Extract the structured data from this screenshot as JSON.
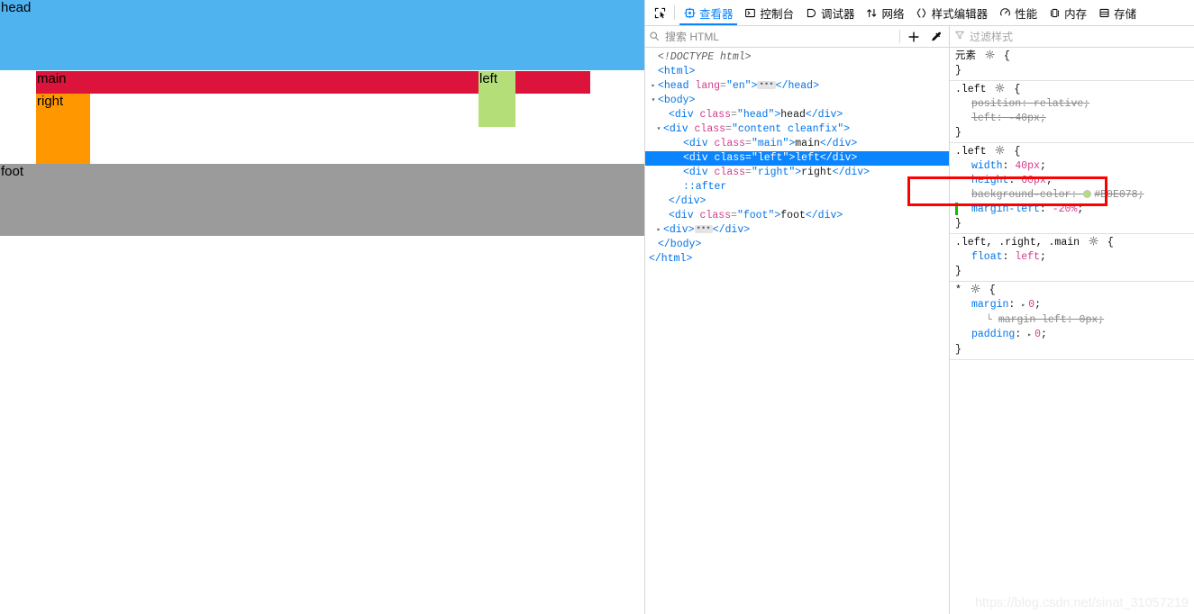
{
  "rendered_page": {
    "blocks": [
      {
        "name": "head",
        "label": "head",
        "color": "#4FB3F0"
      },
      {
        "name": "main",
        "label": "main",
        "color": "#DC143C"
      },
      {
        "name": "left",
        "label": "left",
        "color": "#B3DE78"
      },
      {
        "name": "right",
        "label": "right",
        "color": "#FF9800"
      },
      {
        "name": "foot",
        "label": "foot",
        "color": "#9B9B9B"
      }
    ]
  },
  "devtools": {
    "picker_icon": "element-picker-icon",
    "tabs": [
      {
        "id": "inspector",
        "label": "查看器",
        "icon": "inspector-icon",
        "active": true
      },
      {
        "id": "console",
        "label": "控制台",
        "icon": "console-icon",
        "active": false
      },
      {
        "id": "debugger",
        "label": "调试器",
        "icon": "debugger-icon",
        "active": false
      },
      {
        "id": "network",
        "label": "网络",
        "icon": "network-icon",
        "active": false
      },
      {
        "id": "style-editor",
        "label": "样式编辑器",
        "icon": "style-editor-icon",
        "active": false
      },
      {
        "id": "performance",
        "label": "性能",
        "icon": "performance-icon",
        "active": false
      },
      {
        "id": "memory",
        "label": "内存",
        "icon": "memory-icon",
        "active": false
      },
      {
        "id": "storage",
        "label": "存储",
        "icon": "storage-icon",
        "active": false
      }
    ],
    "search": {
      "placeholder": "搜索 HTML",
      "icon": "search-icon",
      "add_node_icon": "plus-icon",
      "eyedropper_icon": "eyedropper-icon"
    },
    "filter": {
      "placeholder": "过滤样式",
      "icon": "funnel-icon"
    },
    "markup": {
      "lines": [
        {
          "type": "doctype",
          "text": "<!DOCTYPE html>",
          "indent": 0,
          "twisty": "none"
        },
        {
          "type": "tag",
          "tag": "html",
          "indent": 0,
          "twisty": "none",
          "open": true
        },
        {
          "type": "collapsed",
          "tag": "head",
          "indent": 0,
          "twisty": "closed",
          "attr_name": "lang",
          "attr_value": "en"
        },
        {
          "type": "tag",
          "tag": "body",
          "indent": 0,
          "twisty": "open",
          "open": true
        },
        {
          "type": "element",
          "tag": "div",
          "indent": 1,
          "twisty": "none",
          "attr_name": "class",
          "attr_value": "head",
          "text": "head"
        },
        {
          "type": "element-open",
          "tag": "div",
          "indent": 1,
          "twisty": "open",
          "attr_name": "class",
          "attr_value": "content cleanfix"
        },
        {
          "type": "element",
          "tag": "div",
          "indent": 2,
          "twisty": "none",
          "attr_name": "class",
          "attr_value": "main",
          "text": "main"
        },
        {
          "type": "element",
          "tag": "div",
          "indent": 2,
          "twisty": "none",
          "attr_name": "class",
          "attr_value": "left",
          "text": "left",
          "selected": true
        },
        {
          "type": "element",
          "tag": "div",
          "indent": 2,
          "twisty": "none",
          "attr_name": "class",
          "attr_value": "right",
          "text": "right"
        },
        {
          "type": "pseudo",
          "text": "::after",
          "indent": 2,
          "twisty": "none"
        },
        {
          "type": "close",
          "tag": "div",
          "indent": 1,
          "twisty": "none"
        },
        {
          "type": "element",
          "tag": "div",
          "indent": 1,
          "twisty": "none",
          "attr_name": "class",
          "attr_value": "foot",
          "text": "foot"
        },
        {
          "type": "collapsed-plain",
          "tag": "div",
          "indent": 1,
          "twisty": "closed"
        },
        {
          "type": "close",
          "tag": "body",
          "indent": 0,
          "twisty": "none"
        },
        {
          "type": "close",
          "tag": "html",
          "indent": 0,
          "twisty": "none"
        }
      ]
    },
    "rules": [
      {
        "selector": "元素",
        "declarations": []
      },
      {
        "selector": ".left",
        "declarations": [
          {
            "prop": "position",
            "value": "relative",
            "overridden": true
          },
          {
            "prop": "left",
            "value": "-40px",
            "overridden": true
          }
        ]
      },
      {
        "selector": ".left",
        "declarations": [
          {
            "prop": "width",
            "value": "40px",
            "overridden": false
          },
          {
            "prop": "height",
            "value": "60px",
            "overridden": false
          },
          {
            "prop": "background-color",
            "value": "#B0E078",
            "overridden": true,
            "swatch": "#B0E078"
          },
          {
            "prop": "margin-left",
            "value": "-20%",
            "overridden": false,
            "marker": true,
            "highlighted": true
          }
        ]
      },
      {
        "selector": ".left, .right, .main",
        "declarations": [
          {
            "prop": "float",
            "value": "left",
            "overridden": false
          }
        ]
      },
      {
        "selector": "*",
        "declarations": [
          {
            "prop": "margin",
            "value": "0",
            "overridden": false,
            "expandable": true
          },
          {
            "prop": "margin left",
            "value": "0px",
            "overridden": true,
            "sub": true
          },
          {
            "prop": "padding",
            "value": "0",
            "overridden": false,
            "expandable": true
          }
        ]
      }
    ],
    "watermark": "https://blog.csdn.net/sinat_31057219"
  }
}
